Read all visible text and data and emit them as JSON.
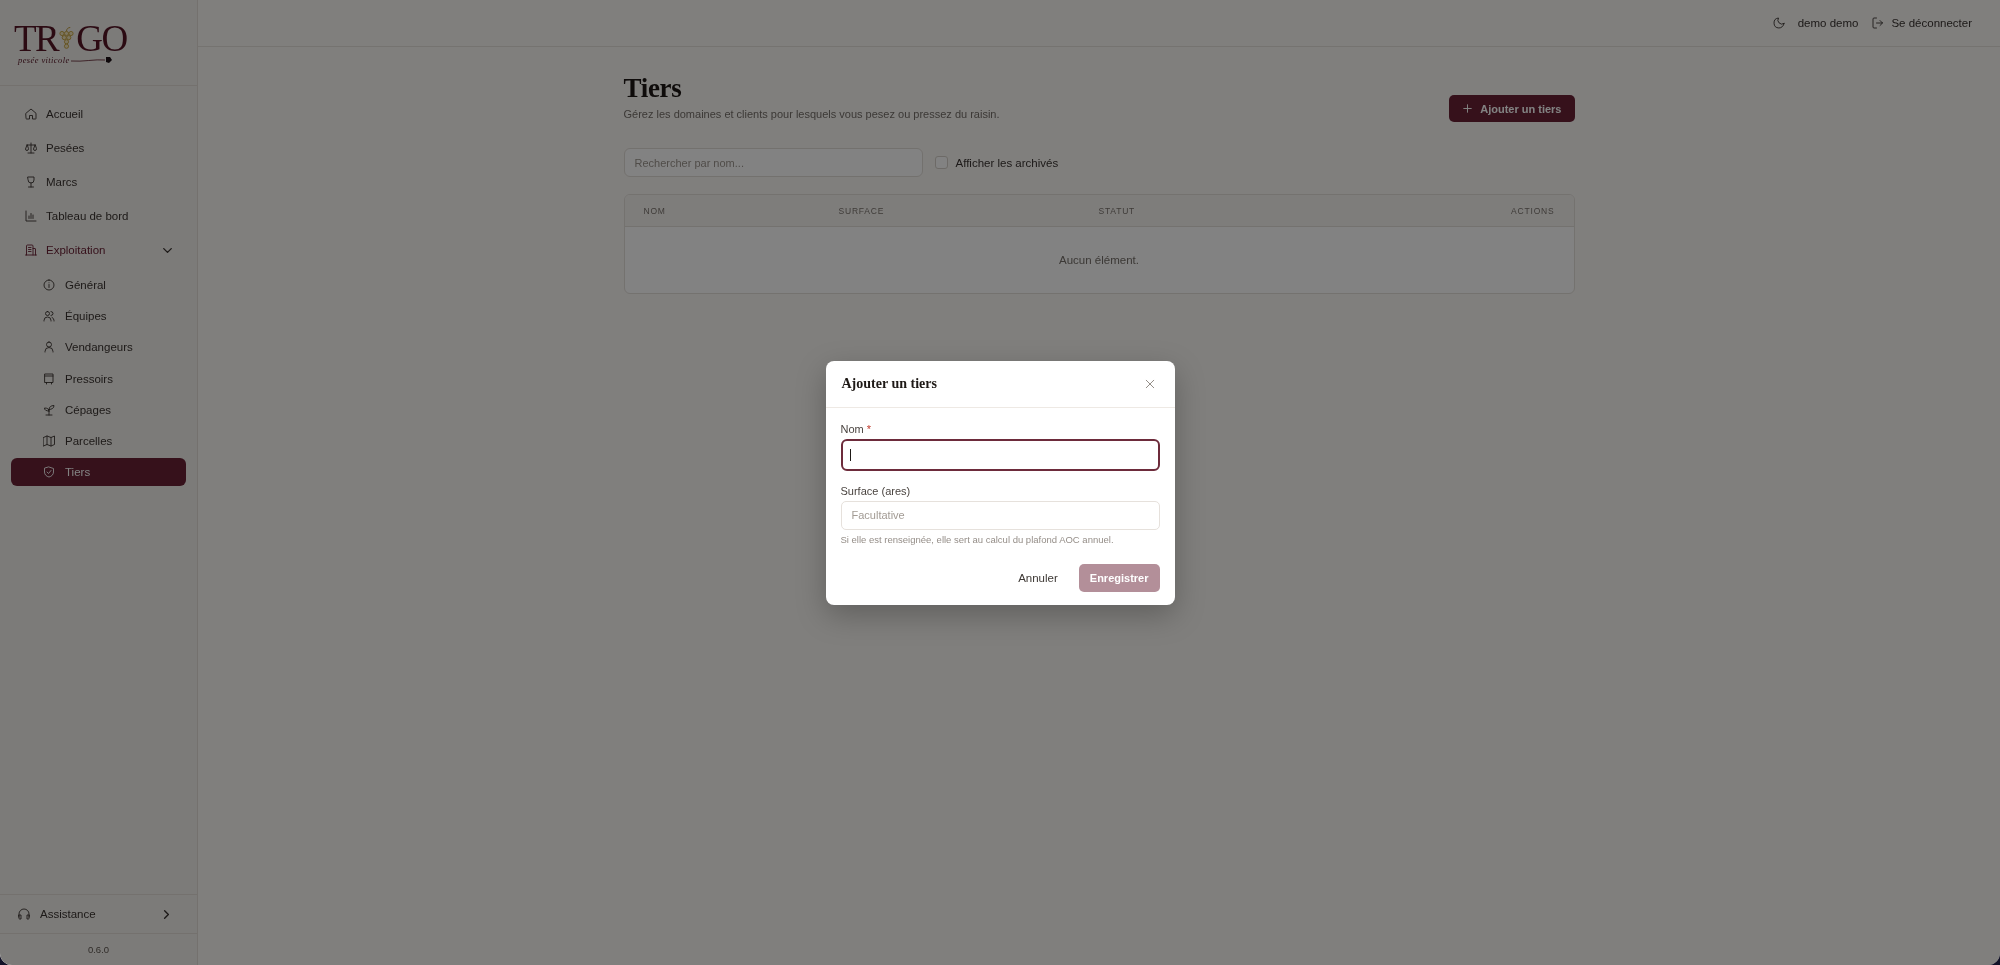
{
  "logo": {
    "left": "TR",
    "right": "GO",
    "tagline": "pesée viticole"
  },
  "sidebar": {
    "items": [
      {
        "label": "Accueil",
        "selected": false
      },
      {
        "label": "Pesées",
        "selected": false
      },
      {
        "label": "Marcs",
        "selected": false
      },
      {
        "label": "Tableau de bord",
        "selected": false
      },
      {
        "label": "Exploitation",
        "selected": false,
        "expanded": true,
        "children": [
          {
            "label": "Général",
            "selected": false
          },
          {
            "label": "Équipes",
            "selected": false
          },
          {
            "label": "Vendangeurs",
            "selected": false
          },
          {
            "label": "Pressoirs",
            "selected": false
          },
          {
            "label": "Cépages",
            "selected": false
          },
          {
            "label": "Parcelles",
            "selected": false
          },
          {
            "label": "Tiers",
            "selected": true
          }
        ]
      }
    ],
    "footer_item": {
      "label": "Assistance"
    },
    "version": "0.6.0"
  },
  "top_bar": {
    "user_name": "demo demo",
    "logout_label": "Se déconnecter"
  },
  "page": {
    "title": "Tiers",
    "subtitle": "Gérez les domaines et clients pour lesquels vous pesez ou pressez du raisin.",
    "add_button": "Ajouter un tiers",
    "search": {
      "placeholder": "Rechercher par nom..."
    },
    "show_archived": {
      "label": "Afficher les archivés",
      "checked": false
    }
  },
  "table": {
    "columns": [
      "NOM",
      "SURFACE",
      "STATUT",
      "ACTIONS"
    ],
    "empty_message": "Aucun élément."
  },
  "modal": {
    "title": "Ajouter un tiers",
    "fields": [
      {
        "label": "Nom",
        "required_mark": "*",
        "focused": true
      },
      {
        "label": "Surface (ares)",
        "placeholder": "Facultative",
        "hint": "Si elle est renseignée, elle sert au calcul du plafond AOC annuel.",
        "focused": false
      }
    ],
    "buttons": [
      {
        "label": "Annuler",
        "kind": "secondary",
        "disabled": false
      },
      {
        "label": "Enregistrer",
        "kind": "primary",
        "disabled": true
      }
    ]
  }
}
